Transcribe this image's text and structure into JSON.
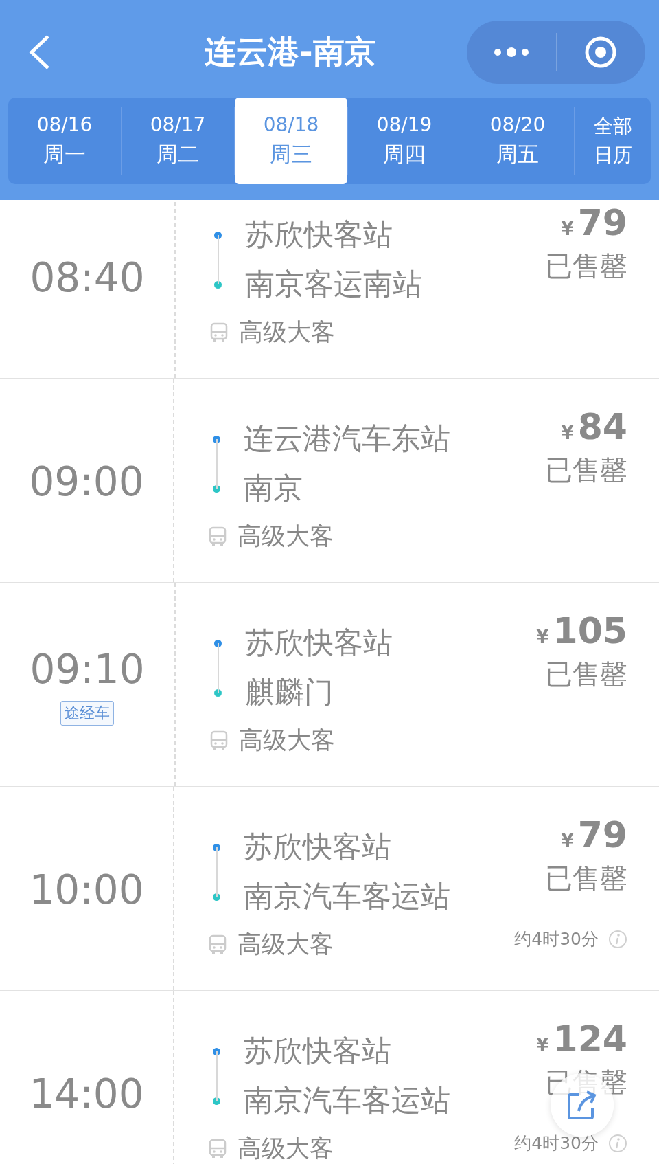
{
  "nav": {
    "title": "连云港-南京"
  },
  "dates": [
    {
      "date": "08/16",
      "weekday": "周一",
      "selected": false
    },
    {
      "date": "08/17",
      "weekday": "周二",
      "selected": false
    },
    {
      "date": "08/18",
      "weekday": "周三",
      "selected": true
    },
    {
      "date": "08/19",
      "weekday": "周四",
      "selected": false
    },
    {
      "date": "08/20",
      "weekday": "周五",
      "selected": false
    }
  ],
  "calendar_tab": {
    "label_lines": [
      "全部",
      "日历"
    ]
  },
  "trips": [
    {
      "time": "08:40",
      "from": "苏欣快客站",
      "to": "南京客运南站",
      "bus_type": "高级大客",
      "currency": "¥",
      "price": "79",
      "status": "已售罄"
    },
    {
      "time": "09:00",
      "from": "连云港汽车东站",
      "to": "南京",
      "bus_type": "高级大客",
      "currency": "¥",
      "price": "84",
      "status": "已售罄"
    },
    {
      "time": "09:10",
      "badge": "途经车",
      "from": "苏欣快客站",
      "to": "麒麟门",
      "bus_type": "高级大客",
      "currency": "¥",
      "price": "105",
      "status": "已售罄"
    },
    {
      "time": "10:00",
      "from": "苏欣快客站",
      "to": "南京汽车客运站",
      "bus_type": "高级大客",
      "currency": "¥",
      "price": "79",
      "status": "已售罄",
      "duration": "约4时30分"
    },
    {
      "time": "14:00",
      "from": "苏欣快客站",
      "to": "南京汽车客运站",
      "bus_type": "高级大客",
      "currency": "¥",
      "price": "124",
      "status": "已售罄",
      "duration": "约4时30分"
    }
  ]
}
